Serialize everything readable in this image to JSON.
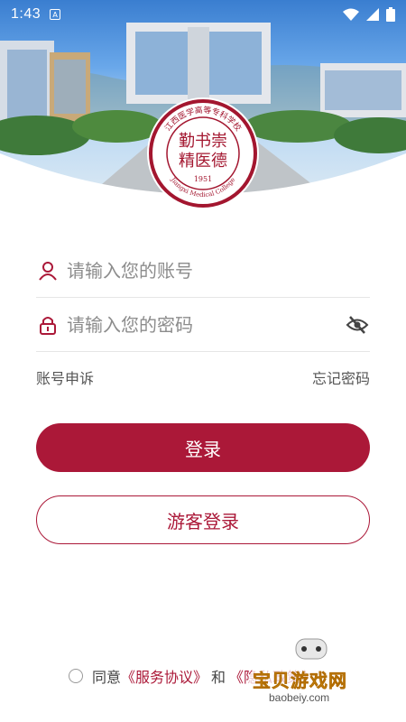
{
  "status_bar": {
    "time": "1:43",
    "app_icon_letter": "A",
    "icons": [
      "wifi-icon",
      "signal-icon",
      "battery-icon"
    ]
  },
  "emblem": {
    "top_text": "江西医学高等专科学校",
    "center_text_lines": [
      "勤书崇",
      "精医德"
    ],
    "year": "1951",
    "bottom_text": "Jiangxi Medical College"
  },
  "form": {
    "account_placeholder": "请输入您的账号",
    "password_placeholder": "请输入您的密码",
    "account_appeal": "账号申诉",
    "forgot_password": "忘记密码"
  },
  "buttons": {
    "login": "登录",
    "guest_login": "游客登录"
  },
  "agreement": {
    "agree": "同意",
    "service_agreement": "《服务协议》",
    "and": "和",
    "privacy_policy": "《隐私政策》"
  },
  "watermark": {
    "text": "宝贝游戏网",
    "url": "baobeiy.com"
  },
  "colors": {
    "brand": "#ab1838",
    "text": "#333333",
    "placeholder": "#8c8c8c"
  }
}
